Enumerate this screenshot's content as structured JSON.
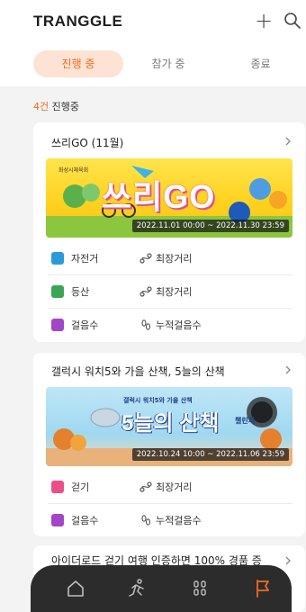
{
  "header": {
    "logo": "TRANGGLE",
    "plus_icon": "plus-icon",
    "search_icon": "search-icon"
  },
  "tabs": [
    {
      "label": "진행 중",
      "active": true
    },
    {
      "label": "참가 중",
      "active": false
    },
    {
      "label": "종료",
      "active": false
    }
  ],
  "count": {
    "number": "4건",
    "suffix": " 진행중"
  },
  "cards": [
    {
      "title": "쓰리GO (11월)",
      "banner": {
        "org": "화성시체육회",
        "headline": "쓰리GO",
        "dates": "2022.11.01 00:00 ~ 2022.11.30 23:59"
      },
      "rows": [
        {
          "type_label": "자전거",
          "type_icon": "bike-icon",
          "metric_label": "최장거리",
          "metric_icon": "route-icon"
        },
        {
          "type_label": "등산",
          "type_icon": "hiking-icon",
          "metric_label": "최장거리",
          "metric_icon": "route-icon"
        },
        {
          "type_label": "걸음수",
          "type_icon": "steps-icon",
          "metric_label": "누적걸음수",
          "metric_icon": "footprints-icon"
        }
      ]
    },
    {
      "title": "갤럭시 워치5와 가을 산책, 5늘의 산책",
      "banner": {
        "top_text": "갤럭시 워치5와 가을 산책",
        "headline": "5늘의 산책",
        "sub": "챌린지",
        "dates": "2022.10.24 10:00 ~ 2022.11.06 23:59"
      },
      "rows": [
        {
          "type_label": "걷기",
          "type_icon": "walking-icon",
          "metric_label": "최장거리",
          "metric_icon": "route-icon"
        },
        {
          "type_label": "걸음수",
          "type_icon": "steps-icon",
          "metric_label": "누적걸음수",
          "metric_icon": "footprints-icon"
        }
      ]
    },
    {
      "title": "아이더로드 걷기 여행 인증하면 100% 경품 증"
    }
  ],
  "bottom_nav": [
    {
      "icon": "home-icon"
    },
    {
      "icon": "running-icon"
    },
    {
      "icon": "grid-icon"
    },
    {
      "icon": "flag-icon",
      "active": true
    }
  ],
  "colors": {
    "accent": "#f26b21",
    "tab_active_bg": "#fde3d3",
    "nav_bg": "#2c2c2c"
  }
}
